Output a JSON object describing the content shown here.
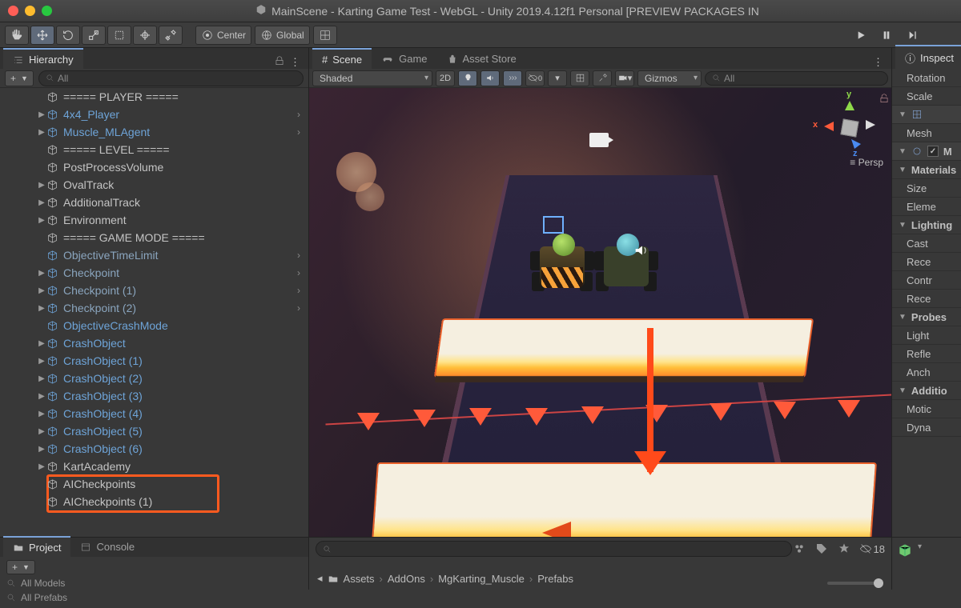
{
  "title": "MainScene - Karting Game Test - WebGL - Unity 2019.4.12f1 Personal [PREVIEW PACKAGES IN",
  "toolbar": {
    "pivot_label": "Center",
    "space_label": "Global"
  },
  "hierarchy": {
    "tab": "Hierarchy",
    "search": "All",
    "items": [
      {
        "label": "===== PLAYER =====",
        "style": "",
        "expand": "",
        "chev": false
      },
      {
        "label": "4x4_Player",
        "style": "blue",
        "expand": "▶",
        "chev": true
      },
      {
        "label": "Muscle_MLAgent",
        "style": "blue",
        "expand": "▶",
        "chev": true
      },
      {
        "label": "===== LEVEL =====",
        "style": "",
        "expand": "",
        "chev": false
      },
      {
        "label": "PostProcessVolume",
        "style": "",
        "expand": "",
        "chev": false
      },
      {
        "label": "OvalTrack",
        "style": "",
        "expand": "▶",
        "chev": false
      },
      {
        "label": "AdditionalTrack",
        "style": "",
        "expand": "▶",
        "chev": false
      },
      {
        "label": "Environment",
        "style": "",
        "expand": "▶",
        "chev": false
      },
      {
        "label": "===== GAME MODE =====",
        "style": "",
        "expand": "",
        "chev": false
      },
      {
        "label": "ObjectiveTimeLimit",
        "style": "dim",
        "expand": "",
        "chev": true
      },
      {
        "label": "Checkpoint",
        "style": "dim",
        "expand": "▶",
        "chev": true
      },
      {
        "label": "Checkpoint (1)",
        "style": "dim",
        "expand": "▶",
        "chev": true
      },
      {
        "label": "Checkpoint (2)",
        "style": "dim",
        "expand": "▶",
        "chev": true
      },
      {
        "label": "ObjectiveCrashMode",
        "style": "blue",
        "expand": "",
        "chev": false
      },
      {
        "label": "CrashObject",
        "style": "blue",
        "expand": "▶",
        "chev": false
      },
      {
        "label": "CrashObject (1)",
        "style": "blue",
        "expand": "▶",
        "chev": false
      },
      {
        "label": "CrashObject (2)",
        "style": "blue",
        "expand": "▶",
        "chev": false
      },
      {
        "label": "CrashObject (3)",
        "style": "blue",
        "expand": "▶",
        "chev": false
      },
      {
        "label": "CrashObject (4)",
        "style": "blue",
        "expand": "▶",
        "chev": false
      },
      {
        "label": "CrashObject (5)",
        "style": "blue",
        "expand": "▶",
        "chev": false
      },
      {
        "label": "CrashObject (6)",
        "style": "blue",
        "expand": "▶",
        "chev": false
      },
      {
        "label": "KartAcademy",
        "style": "",
        "expand": "▶",
        "chev": false
      },
      {
        "label": "AICheckpoints",
        "style": "",
        "expand": "",
        "chev": false
      },
      {
        "label": "AICheckpoints (1)",
        "style": "",
        "expand": "",
        "chev": false
      }
    ]
  },
  "project": {
    "tab_project": "Project",
    "tab_console": "Console",
    "rows": [
      "All Models",
      "All Prefabs"
    ]
  },
  "scene": {
    "tab_scene": "Scene",
    "tab_game": "Game",
    "tab_store": "Asset Store",
    "shading": "Shaded",
    "mode_2d": "2D",
    "gizmos": "Gizmos",
    "search": "All",
    "axis_x": "x",
    "axis_y": "y",
    "axis_z": "z",
    "proj_label": "Persp"
  },
  "breadcrumb": [
    "Assets",
    "AddOns",
    "MgKarting_Muscle",
    "Prefabs"
  ],
  "hidden_count": "18",
  "inspector": {
    "tab": "Inspect",
    "rows": [
      {
        "label": "Rotation",
        "type": "plain"
      },
      {
        "label": "Scale",
        "type": "plain"
      },
      {
        "label": "__grid__",
        "type": "tools"
      },
      {
        "label": "Mesh",
        "type": "plain"
      },
      {
        "label": "M",
        "type": "component"
      },
      {
        "label": "Materials",
        "type": "section"
      },
      {
        "label": "Size",
        "type": "plain"
      },
      {
        "label": "Eleme",
        "type": "plain"
      },
      {
        "label": "Lighting",
        "type": "section"
      },
      {
        "label": "Cast",
        "type": "plain"
      },
      {
        "label": "Rece",
        "type": "plain"
      },
      {
        "label": "Contr",
        "type": "plain"
      },
      {
        "label": "Rece",
        "type": "plain"
      },
      {
        "label": "Probes",
        "type": "section"
      },
      {
        "label": "Light",
        "type": "plain"
      },
      {
        "label": "Refle",
        "type": "plain"
      },
      {
        "label": "Anch",
        "type": "plain"
      },
      {
        "label": "Additio",
        "type": "section"
      },
      {
        "label": "Motic",
        "type": "plain"
      },
      {
        "label": "Dyna",
        "type": "plain"
      }
    ]
  }
}
